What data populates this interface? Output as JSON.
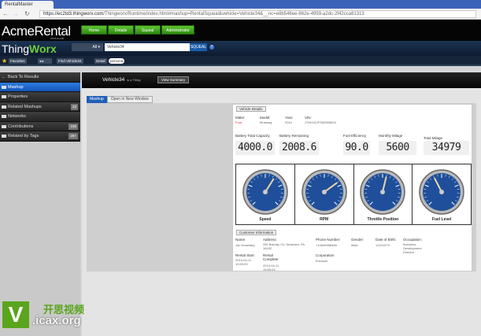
{
  "browser": {
    "tab_title": "RentalMaster",
    "url_host": "https://ec2td3.thingworx.com",
    "url_path": "/Thingworx/Runtime/index.html#mashup=RentalSqueal&vehicle=Vehicle34&__nc=e8b546ee-862e-4959-a2dc-2f42cca61313"
  },
  "header": {
    "logo": "AcmeRental",
    "logo_sub": "rent-a-car",
    "nav": [
      "Home",
      "Details",
      "Squeal",
      "Administrator"
    ]
  },
  "thingworx": {
    "logo_a": "Thing",
    "logo_b": "Worx",
    "scope": "All",
    "search_value": "Vehicle34",
    "squeal_button": "SQUEAL",
    "help": "?"
  },
  "favbar": {
    "favorites": "Favorites",
    "find": "Find Vehicle34",
    "detail": "Detail",
    "persona": "persona"
  },
  "sidebar": {
    "items": [
      {
        "label": "Back To Results"
      },
      {
        "label": "Mashup",
        "active": true
      },
      {
        "label": "Properties"
      },
      {
        "label": "Related Mashups",
        "badge": "23"
      },
      {
        "label": "Networks"
      },
      {
        "label": "Contributions",
        "badge": "100"
      },
      {
        "label": "Related by Tags",
        "badge": "25+"
      }
    ]
  },
  "main": {
    "thing_name": "Vehicle34",
    "thing_type": "is a Thing",
    "view_summary": "View Summary",
    "tab_mashup": "Mashup",
    "tab_open": "Open in New Window"
  },
  "vehicle": {
    "group": "Vehicle Details",
    "make_label": "Make:",
    "make": "Ford",
    "model_label": "Model:",
    "model": "Mustang",
    "year_label": "Year:",
    "year": "2010",
    "vin_label": "VIN:",
    "vin": "JTKKHZJP308906604",
    "metrics": [
      {
        "label": "Battery Total Capacity",
        "value": "4000.0"
      },
      {
        "label": "Battery Remaining",
        "value": "2008.6"
      },
      {
        "label": "Fuel Efficiency",
        "value": "90.0"
      },
      {
        "label": "Monthly Milage",
        "value": "5600"
      },
      {
        "label": "Total Milage",
        "value": "34979"
      }
    ]
  },
  "gauges": [
    {
      "label": "Speed",
      "level": 0.62
    },
    {
      "label": "RPM",
      "level": 0.7
    },
    {
      "label": "Throttle Position",
      "level": 0.55
    },
    {
      "label": "Fuel Level",
      "level": 0.4
    }
  ],
  "customer": {
    "group": "Customer Information",
    "name_label": "Name:",
    "name": "Jan Sowelsky",
    "address_label": "Address:",
    "address": "250 Barclay Cir, Newtown, PA 18432",
    "phone_label": "Phone Number:",
    "phone": "+14845958465",
    "gender_label": "Gender:",
    "gender": "Male",
    "dob_label": "Date of Birth:",
    "dob": "1/10/1979",
    "occupation_label": "Occupation:",
    "occupation": "Business Development Director",
    "rental_start_label": "Rental Start",
    "rental_start": "2013-04-11 19:55:03",
    "rental_complete_label": "Rental Complete",
    "rental_complete": "2013-04-11 19:55:03",
    "corp_label": "Corporation",
    "corp": "Ericsson"
  },
  "watermark": {
    "v": "V",
    "cn": "开思视频",
    "site": ".icax.org"
  }
}
